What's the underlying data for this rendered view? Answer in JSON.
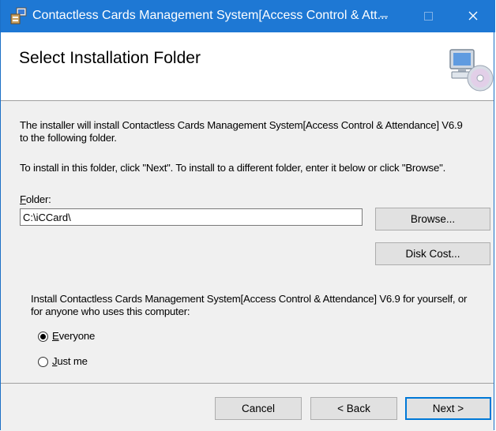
{
  "window": {
    "title": "Contactless Cards Management System[Access Control & Att...",
    "controls": {
      "minimize": "—",
      "maximize": "☐",
      "close": "✕"
    },
    "accent_color": "#1e78d4"
  },
  "header": {
    "title": "Select Installation Folder",
    "icon": "computer-cd-icon"
  },
  "body": {
    "intro_line1": "The installer will install Contactless Cards Management System[Access Control & Attendance] V6.9",
    "intro_line2": "to the following folder.",
    "instructions": "To install in this folder, click \"Next\". To install to a different folder, enter it below or click \"Browse\".",
    "folder_label_first": "F",
    "folder_label_rest": "older:",
    "folder_value": "C:\\iCCard\\",
    "browse_label": "Browse...",
    "disk_cost_label": "Disk Cost...",
    "install_for_line1": "Install Contactless Cards Management System[Access Control & Attendance] V6.9 for yourself, or",
    "install_for_line2": "for anyone who uses this computer:",
    "options": [
      {
        "first": "E",
        "rest": "veryone",
        "selected": true
      },
      {
        "first": "J",
        "rest": "ust me",
        "selected": false
      }
    ]
  },
  "footer": {
    "cancel_label": "Cancel",
    "back_label": "< Back",
    "next_label": "Next >"
  }
}
